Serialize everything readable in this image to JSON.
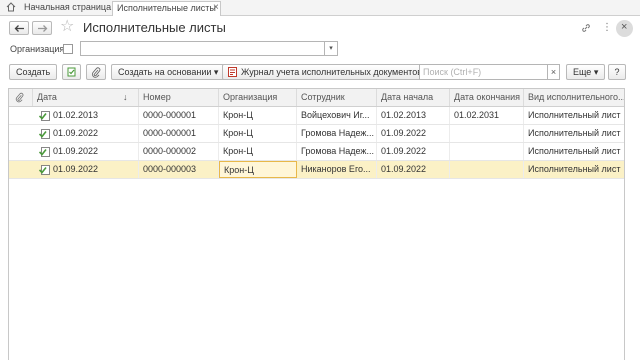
{
  "tabs": {
    "home_label": "Начальная страница",
    "active_label": "Исполнительные листы",
    "close_glyph": "×"
  },
  "header": {
    "title": "Исполнительные листы",
    "star_glyph": "☆",
    "more_glyph": "⋮",
    "close_glyph": "×"
  },
  "filter": {
    "org_label": "Организация:",
    "org_value": "",
    "drop_glyph": "▾"
  },
  "toolbar": {
    "create_label": "Создать",
    "create_based_label": "Создать на основании ▾",
    "journal_label": "Журнал учета исполнительных документов",
    "search_placeholder": "Поиск (Ctrl+F)",
    "search_clear": "×",
    "more_label": "Еще ▾",
    "help_label": "?"
  },
  "table": {
    "columns": [
      "Дата",
      "Номер",
      "Организация",
      "Сотрудник",
      "Дата начала",
      "Дата окончания",
      "Вид исполнительного..."
    ],
    "sort_glyph": "↓",
    "rows": [
      {
        "date": "01.02.2013",
        "number": "0000-000001",
        "org": "Крон-Ц",
        "employee": "Войцехович Иг...",
        "start": "01.02.2013",
        "end": "01.02.2031",
        "kind": "Исполнительный лист"
      },
      {
        "date": "01.09.2022",
        "number": "0000-000001",
        "org": "Крон-Ц",
        "employee": "Громова Надеж...",
        "start": "01.09.2022",
        "end": "",
        "kind": "Исполнительный лист"
      },
      {
        "date": "01.09.2022",
        "number": "0000-000002",
        "org": "Крон-Ц",
        "employee": "Громова Надеж...",
        "start": "01.09.2022",
        "end": "",
        "kind": "Исполнительный лист"
      },
      {
        "date": "01.09.2022",
        "number": "0000-000003",
        "org": "Крон-Ц",
        "employee": "Никаноров Его...",
        "start": "01.09.2022",
        "end": "",
        "kind": "Исполнительный лист"
      }
    ]
  },
  "colors": {
    "selected_row": "#fbf1c6",
    "focus_border": "#e8b84a",
    "doc_icon": "#4a9a3a"
  }
}
